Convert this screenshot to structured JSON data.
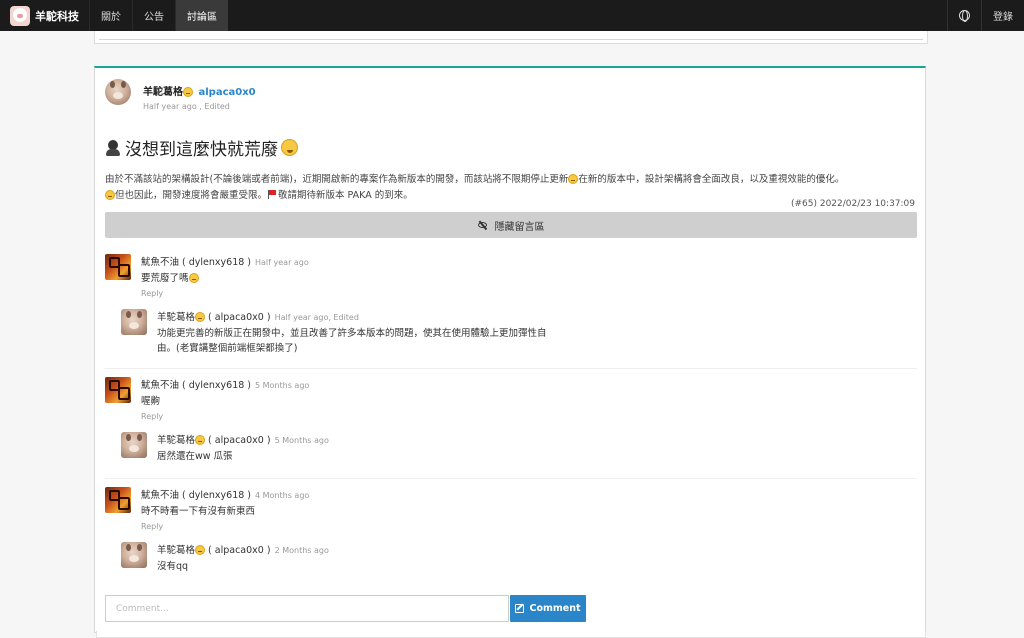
{
  "nav": {
    "brand": "羊駝科技",
    "items": [
      "關於",
      "公告",
      "討論區"
    ],
    "active_index": 2,
    "right_label": "登錄",
    "globe_icon": "globe-icon"
  },
  "post": {
    "author": "羊駝葛格",
    "author_id": "alpaca0x0",
    "time": "Half year ago , Edited",
    "title": "沒想到這麼快就荒廢",
    "body_part1": "由於不滿該站的架構設計(不論後端或者前端)，近期開啟新的專案作為新版本的開發，而該站將不限期停止更新",
    "body_part2": "在新的版本中，設計架構將會全面改良，以及重視效能的優化。",
    "body_part3": "但也因此，開發速度將會嚴重受限。",
    "body_part4": "敬請期待新版本 PAKA 的到來。",
    "id_line": "(#65) 2022/02/23 10:37:09",
    "hide_label": "隱藏留言區"
  },
  "comments": [
    {
      "author": "魷魚不油 ( dylenxy618 )",
      "time": "Half year ago",
      "text": "要荒廢了嗎",
      "reply": "Reply",
      "response": {
        "author": "羊駝葛格",
        "author_id": "( alpaca0x0 )",
        "time": "Half year ago, Edited",
        "text_line1": "功能更完善的新版正在開發中，並且改善了許多本版本的問題，使其在使用體驗上更加彈性自",
        "text_line2": "由。(老實講整個前端框架都換了)"
      }
    },
    {
      "author": "魷魚不油 ( dylenxy618 )",
      "time": "5 Months ago",
      "text": "喔齁",
      "reply": "Reply",
      "response": {
        "author": "羊駝葛格",
        "author_id": "( alpaca0x0 )",
        "time": "5 Months ago",
        "text_line1": "居然還在ww 瓜張"
      }
    },
    {
      "author": "魷魚不油 ( dylenxy618 )",
      "time": "4 Months ago",
      "text": "時不時看一下有沒有新東西",
      "reply": "Reply",
      "response": {
        "author": "羊駝葛格",
        "author_id": "( alpaca0x0 )",
        "time": "2 Months ago",
        "text_line1": "沒有qq"
      }
    }
  ],
  "comment_form": {
    "placeholder": "Comment...",
    "button_label": "Comment"
  },
  "colors": {
    "navbar": "#1b1b1b",
    "accent_teal": "#1aa791",
    "link_blue": "#2a86c8",
    "button_grey": "#cfcfcf"
  }
}
